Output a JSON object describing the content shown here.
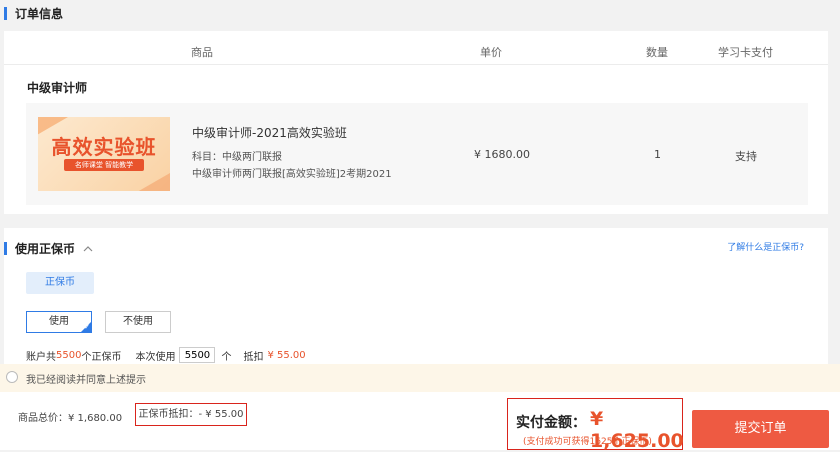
{
  "order_section": {
    "title": "订单信息"
  },
  "table_headers": {
    "product": "商品",
    "unit_price": "单价",
    "quantity": "数量",
    "card_pay": "学习卡支付"
  },
  "category": "中级审计师",
  "product": {
    "thumb_title": "高效实验班",
    "thumb_tag": "名师课堂 智能教学",
    "name": "中级审计师-2021高效实验班",
    "subject": "科目：中级两门联报",
    "detail": "中级审计师两门联报[高效实验班]2考期2021",
    "price": "¥ 1680.00",
    "quantity": "1",
    "card_support": "支持"
  },
  "coin_section": {
    "title": "使用正保币",
    "help_link": "了解什么是正保币?",
    "tab_label": "正保币",
    "use_label": "使用",
    "no_use_label": "不使用",
    "account_prefix": "账户共",
    "account_amount": "5500",
    "account_suffix": "个正保币",
    "use_prefix": "本次使用",
    "use_value": "5500",
    "use_suffix": "个",
    "deduct_prefix": "抵扣",
    "deduct_amount": "¥ 55.00"
  },
  "notice": {
    "text": "我已经阅读并同意上述提示"
  },
  "summary": {
    "total": "商品总价：¥ 1,680.00",
    "deduction": "正保币抵扣：- ¥ 55.00",
    "pay_label": "实付金额：",
    "pay_amount": "¥ 1,625.00",
    "pay_note": "(支付成功可获得1625个正保币)",
    "submit": "提交订单"
  },
  "colors": {
    "accent": "#2f7be5",
    "price_red": "#e8532c",
    "submit_bg": "#ee5a42",
    "highlight_border": "#d9241c"
  }
}
